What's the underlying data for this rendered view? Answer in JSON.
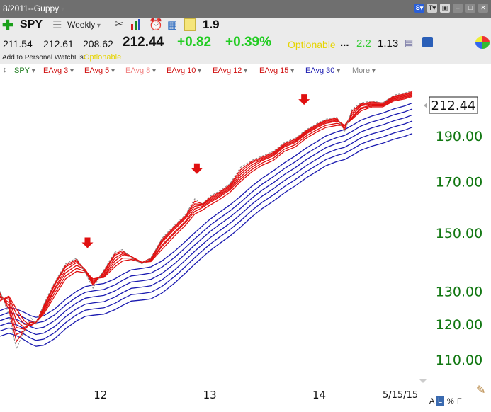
{
  "window": {
    "title": "8/2011--Guppy"
  },
  "toolbar": {
    "symbol": "SPY",
    "period": "Weekly",
    "readout": "1.9"
  },
  "quote": {
    "open": "211.54",
    "high": "212.61",
    "low": "208.62",
    "last": "212.44",
    "change": "+0.82",
    "change_pct": "+0.39%",
    "optionable": "Optionable",
    "dots": "...",
    "val_green": "2.2",
    "val_black": "1.13"
  },
  "watchlist": {
    "add_label": "Add to Personal WatchList",
    "optionable": "Optionable"
  },
  "indicators": {
    "spy": "SPY",
    "eavg3": "EAvg 3",
    "eavg5": "EAvg 5",
    "eavg8": "EAvg 8",
    "eavg10": "EAvg 10",
    "eavg12": "EAvg 12",
    "eavg15": "EAvg 15",
    "eavg30": "EAvg 30",
    "more": "More"
  },
  "colors": {
    "short_term": "#e01010",
    "long_term": "#1a1ab0",
    "price": "#888888",
    "axis_text": "#117711",
    "arrow": "#e01010"
  },
  "footer": {
    "date": "5/15/15",
    "btn_a": "A",
    "btn_l": "L",
    "btn_pct": "%",
    "btn_f": "F"
  },
  "chart_data": {
    "type": "line",
    "title": "",
    "price_label": "212.44",
    "ylim": [
      105,
      216
    ],
    "yticks": [
      "110.00",
      "120.00",
      "130.00",
      "150.00",
      "170.00",
      "190.00"
    ],
    "x_ticks": [
      "12",
      "13",
      "14"
    ],
    "x_range": [
      2011.6,
      2015.37
    ],
    "arrows": [
      {
        "x": 2012.4
      },
      {
        "x": 2013.4
      },
      {
        "x": 2014.38
      }
    ],
    "series": [
      {
        "name": "SPY",
        "group": "price",
        "x": [
          2011.6,
          2011.68,
          2011.75,
          2011.82,
          2011.88,
          2011.93,
          2012.0,
          2012.1,
          2012.2,
          2012.3,
          2012.38,
          2012.45,
          2012.55,
          2012.65,
          2012.72,
          2012.8,
          2012.9,
          2012.98,
          2013.08,
          2013.2,
          2013.3,
          2013.38,
          2013.45,
          2013.52,
          2013.6,
          2013.7,
          2013.8,
          2013.9,
          2014.0,
          2014.1,
          2014.2,
          2014.3,
          2014.4,
          2014.5,
          2014.58,
          2014.68,
          2014.75,
          2014.82,
          2014.9,
          2015.0,
          2015.1,
          2015.2,
          2015.3,
          2015.37
        ],
        "values": [
          130,
          123,
          113,
          118,
          122,
          120,
          126,
          133,
          139,
          141,
          136,
          131,
          137,
          143,
          144,
          141,
          139,
          141,
          148,
          153,
          157,
          163,
          161,
          164,
          166,
          169,
          176,
          179,
          181,
          183,
          187,
          189,
          193,
          196,
          198,
          199,
          192,
          203,
          206,
          207,
          206,
          210,
          211,
          212.4
        ]
      },
      {
        "name": "EAvg 3",
        "group": "short",
        "values": [
          129.5,
          124.5,
          115,
          118,
          121,
          120.5,
          125.5,
          132.5,
          138.5,
          140.5,
          136.5,
          132,
          136.5,
          142.5,
          143.5,
          141.5,
          139.5,
          141,
          147.5,
          152.5,
          156.5,
          162,
          161,
          163.5,
          165.5,
          168.5,
          175,
          178.5,
          180.5,
          182.5,
          186.5,
          188.5,
          192.5,
          195.5,
          197.5,
          198.5,
          193,
          202,
          205.5,
          206.5,
          206,
          209.5,
          210.5,
          211.8
        ]
      },
      {
        "name": "EAvg 5",
        "group": "short",
        "values": [
          129,
          125.5,
          117,
          118,
          120.5,
          120.5,
          125,
          132,
          138,
          140,
          137,
          132.5,
          136,
          142,
          143,
          141.5,
          139.5,
          140.8,
          147,
          152,
          156,
          161,
          160.8,
          163,
          165,
          168,
          174,
          178,
          180,
          182,
          186,
          188,
          192,
          195,
          197,
          198,
          194,
          201,
          205,
          206,
          206,
          209,
          210,
          211.3
        ]
      },
      {
        "name": "EAvg 8",
        "group": "short",
        "values": [
          128.5,
          126.5,
          119,
          118.5,
          120,
          120.5,
          124.5,
          131,
          137,
          139.5,
          137,
          133,
          135.5,
          141,
          142.5,
          141.5,
          139.5,
          140.5,
          146.5,
          151.5,
          155.5,
          160,
          160.5,
          162.5,
          164.5,
          167.5,
          173,
          177,
          179.5,
          181.5,
          185.5,
          187.5,
          191.5,
          194.5,
          196.5,
          197.5,
          195,
          200,
          204.5,
          205.5,
          205.5,
          208.5,
          209.5,
          210.8
        ]
      },
      {
        "name": "EAvg 10",
        "group": "short",
        "values": [
          128,
          127.5,
          121,
          119,
          119.8,
          120.5,
          124,
          130.5,
          136,
          138.5,
          137,
          133.5,
          135,
          140,
          142,
          141.5,
          139.5,
          140.2,
          145.5,
          150.5,
          154.5,
          159,
          160,
          162,
          164,
          167,
          172,
          176,
          179,
          181,
          185,
          187,
          191,
          194,
          196,
          197,
          195,
          199,
          203.5,
          205,
          205,
          208,
          209,
          210.3
        ]
      },
      {
        "name": "EAvg 12",
        "group": "short",
        "values": [
          127.5,
          128,
          123,
          120,
          119.5,
          120.5,
          123.5,
          129.5,
          135,
          137.5,
          136.5,
          134,
          134.8,
          139,
          141,
          141,
          139.5,
          140,
          145,
          150,
          154,
          158,
          159.5,
          161.5,
          163.5,
          166.5,
          171,
          175,
          178,
          180,
          184,
          186,
          190,
          193,
          195,
          196,
          195,
          198.5,
          203,
          204.5,
          204.5,
          207.5,
          208.5,
          209.8
        ]
      },
      {
        "name": "EAvg 15",
        "group": "short",
        "values": [
          127,
          128.5,
          124.5,
          121,
          119.5,
          120.5,
          123,
          128.5,
          134,
          136.5,
          136,
          134,
          134.5,
          138,
          140,
          140.5,
          139.5,
          139.8,
          144,
          149,
          153,
          157,
          158.5,
          160.5,
          162.5,
          165.5,
          170,
          174,
          177,
          179,
          183,
          185,
          189,
          192,
          194,
          195,
          195,
          198,
          202,
          204,
          204,
          207,
          208,
          209.3
        ]
      },
      {
        "name": "EAvg 30",
        "group": "long",
        "values": [
          124,
          125,
          124.5,
          123.5,
          122.5,
          122,
          122.5,
          124.5,
          127.5,
          130,
          131.5,
          132,
          132.5,
          134,
          135.5,
          137,
          137.5,
          138,
          140,
          143.5,
          147,
          150,
          152.5,
          155,
          157.5,
          160.5,
          164,
          168,
          171.5,
          174.5,
          178,
          181,
          184.5,
          187.5,
          190,
          192,
          193,
          195,
          197.5,
          199.5,
          201,
          203,
          204.5,
          206
        ]
      }
    ]
  }
}
